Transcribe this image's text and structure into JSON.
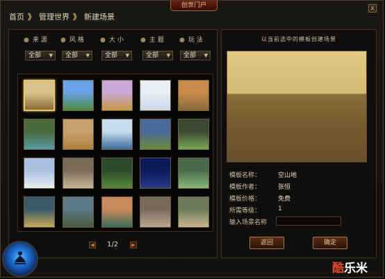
{
  "window": {
    "title": "创世门户",
    "close_label": "X"
  },
  "breadcrumb": {
    "home": "首页",
    "sep1": "》",
    "world": "管理世界",
    "sep2": "》",
    "current": "新建场景"
  },
  "filters": [
    {
      "label": "来源",
      "value": "全部"
    },
    {
      "label": "风格",
      "value": "全部"
    },
    {
      "label": "大小",
      "value": "全部"
    },
    {
      "label": "主题",
      "value": "全部"
    },
    {
      "label": "玩法",
      "value": "全部"
    }
  ],
  "filter_bullet": "●",
  "select_arrow": "▼",
  "templates": [
    {
      "name": "空山地",
      "selected": true,
      "colors": [
        "#d9c28a",
        "#8a6a38"
      ]
    },
    {
      "name": "",
      "selected": false,
      "colors": [
        "#6aa2e8",
        "#4e8a3a"
      ]
    },
    {
      "name": "",
      "selected": false,
      "colors": [
        "#c9a8d8",
        "#c8963e"
      ]
    },
    {
      "name": "",
      "selected": false,
      "colors": [
        "#e8eef6",
        "#c8d8e8"
      ]
    },
    {
      "name": "",
      "selected": false,
      "colors": [
        "#c88a4a",
        "#8a6a3a"
      ]
    },
    {
      "name": "",
      "selected": false,
      "colors": [
        "#4a6a3a",
        "#5a9aa8"
      ]
    },
    {
      "name": "",
      "selected": false,
      "colors": [
        "#c8a070",
        "#b08040"
      ]
    },
    {
      "name": "",
      "selected": false,
      "colors": [
        "#c8dcf0",
        "#3a6a9a"
      ]
    },
    {
      "name": "",
      "selected": false,
      "colors": [
        "#4a6a9a",
        "#6a8a3a"
      ]
    },
    {
      "name": "",
      "selected": false,
      "colors": [
        "#3a4a32",
        "#7aa858"
      ]
    },
    {
      "name": "",
      "selected": false,
      "colors": [
        "#aac0e0",
        "#e8eef4"
      ]
    },
    {
      "name": "",
      "selected": false,
      "colors": [
        "#7a6a58",
        "#c8b898"
      ]
    },
    {
      "name": "",
      "selected": false,
      "colors": [
        "#2a4a2a",
        "#5a8a3a"
      ]
    },
    {
      "name": "",
      "selected": false,
      "colors": [
        "#0a1a5a",
        "#2a3a8a"
      ]
    },
    {
      "name": "",
      "selected": false,
      "colors": [
        "#4a6a4a",
        "#8ab87a"
      ]
    },
    {
      "name": "",
      "selected": false,
      "colors": [
        "#3a5a6a",
        "#c8a85a"
      ]
    },
    {
      "name": "",
      "selected": false,
      "colors": [
        "#5a7a8a",
        "#4a5a3a"
      ]
    },
    {
      "name": "",
      "selected": false,
      "colors": [
        "#c88a5a",
        "#3a6a5a"
      ]
    },
    {
      "name": "",
      "selected": false,
      "colors": [
        "#7a6a5a",
        "#b8a890"
      ]
    },
    {
      "name": "",
      "selected": false,
      "colors": [
        "#6a7a5a",
        "#c8b890"
      ]
    }
  ],
  "pager": {
    "prev": "◀",
    "text": "1/2",
    "next": "▶"
  },
  "preview": {
    "caption": "以当前选中的模板创建场景"
  },
  "info": {
    "name_label": "模板名称：",
    "name_value": "空山地",
    "author_label": "模板作者：",
    "author_value": "张恒",
    "price_label": "模板价格：",
    "price_value": "免费",
    "level_label": "所需等级：",
    "level_value": "1",
    "input_label": "输入场景名称",
    "input_value": ""
  },
  "buttons": {
    "back": "返回",
    "confirm": "确定"
  },
  "watermark": {
    "part1": "酷",
    "part2": "乐米"
  }
}
